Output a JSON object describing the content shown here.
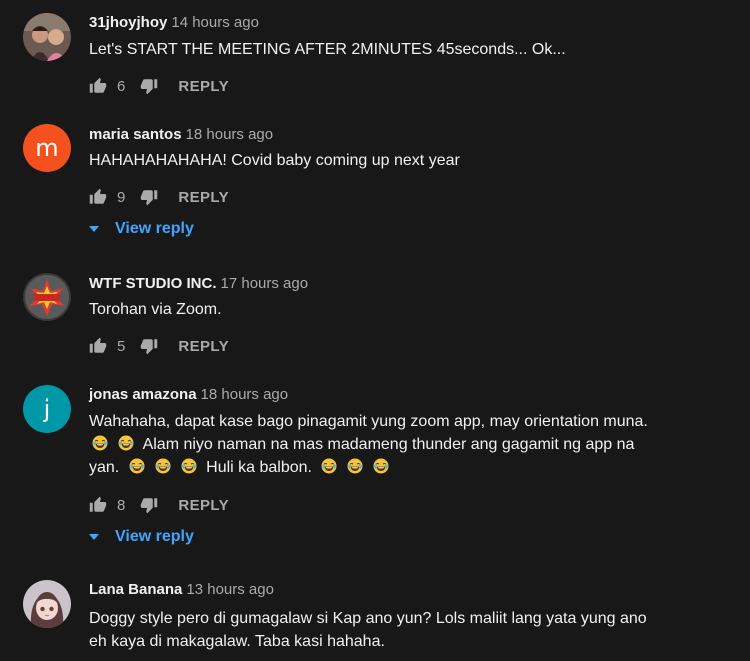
{
  "labels": {
    "reply": "REPLY",
    "view_reply": "View reply"
  },
  "colors": {
    "background": "#181818",
    "link": "#3ea6ff",
    "muted": "#aaaaaa"
  },
  "comments": [
    {
      "author": "31jhoyjhoy",
      "time": "14 hours ago",
      "avatar_icon": "photo-avatar-icon",
      "lines": [
        "Let's START THE MEETING AFTER 2MINUTES 45seconds... Ok..."
      ],
      "likes": "6"
    },
    {
      "author": "maria santos",
      "time": "18 hours ago",
      "avatar_letter": "m",
      "avatar_color": "#f4511e",
      "lines": [
        "HAHAHAHAHAHA! Covid baby coming up next year"
      ],
      "likes": "9"
    },
    {
      "author": "WTF STUDIO INC.",
      "time": "17 hours ago",
      "avatar_icon": "wtf-logo-avatar-icon",
      "lines": [
        "Torohan via Zoom."
      ],
      "likes": "5"
    },
    {
      "author": "jonas amazona",
      "time": "18 hours ago",
      "avatar_letter": "j",
      "avatar_color": "#0097a7",
      "lines": [
        "Wahahaha, dapat kase bago pinagamit yung zoom app, may orientation muna.",
        "Alam niyo naman na mas madameng thunder ang gagamit ng app na",
        "yan.",
        "Huli ka balbon."
      ],
      "emoji_icon": "laughing-tears-emoji-icon",
      "likes": "8"
    },
    {
      "author": "Lana Banana",
      "time": "13 hours ago",
      "avatar_icon": "anime-girl-avatar-icon",
      "lines": [
        "Doggy style pero di gumagalaw si Kap ano yun? Lols maliit lang yata yung ano",
        "eh kaya di makagalaw. Taba kasi hahaha."
      ]
    }
  ]
}
